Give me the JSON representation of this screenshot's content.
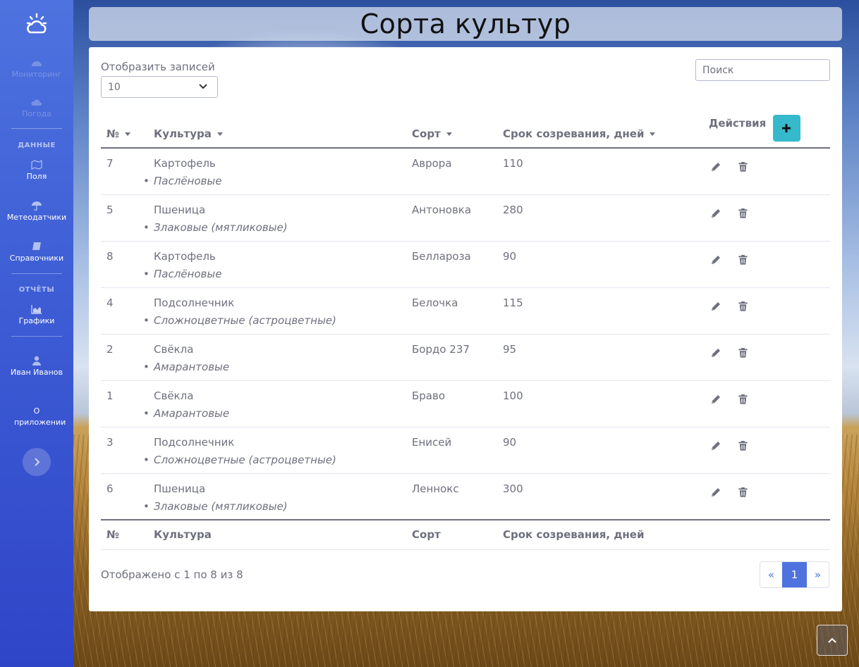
{
  "sidebar": {
    "items": [
      {
        "label": "Мониторинг",
        "icon": "gauge-icon",
        "enabled": false
      },
      {
        "label": "Погода",
        "icon": "weather-icon",
        "enabled": false
      },
      {
        "label": "Поля",
        "icon": "map-icon",
        "enabled": true
      },
      {
        "label": "Метеодатчики",
        "icon": "umbrella-icon",
        "enabled": true
      },
      {
        "label": "Справочники",
        "icon": "book-icon",
        "enabled": true
      },
      {
        "label": "Графики",
        "icon": "chart-icon",
        "enabled": true
      },
      {
        "label": "Иван Иванов",
        "icon": "user-icon",
        "enabled": true
      },
      {
        "label": "О приложении",
        "icon": "",
        "enabled": true
      }
    ],
    "headings": {
      "data": "ДАННЫЕ",
      "reports": "ОТЧЁТЫ"
    }
  },
  "page": {
    "title": "Сорта культур"
  },
  "controls": {
    "length_label": "Отобразить записей",
    "length_value": "10",
    "search_placeholder": "Поиск"
  },
  "table": {
    "columns": [
      "№",
      "Культура",
      "Сорт",
      "Срок созревания, дней",
      "Действия"
    ],
    "rows": [
      {
        "id": "7",
        "culture": "Картофель",
        "family": "Паслёновые",
        "variety": "Аврора",
        "days": "110"
      },
      {
        "id": "5",
        "culture": "Пшеница",
        "family": "Злаковые (мятликовые)",
        "variety": "Антоновка",
        "days": "280"
      },
      {
        "id": "8",
        "culture": "Картофель",
        "family": "Паслёновые",
        "variety": "Беллароза",
        "days": "90"
      },
      {
        "id": "4",
        "culture": "Подсолнечник",
        "family": "Сложноцветные (астроцветные)",
        "variety": "Белочка",
        "days": "115"
      },
      {
        "id": "2",
        "culture": "Свёкла",
        "family": "Амарантовые",
        "variety": "Бордо 237",
        "days": "95"
      },
      {
        "id": "1",
        "culture": "Свёкла",
        "family": "Амарантовые",
        "variety": "Браво",
        "days": "100"
      },
      {
        "id": "3",
        "culture": "Подсолнечник",
        "family": "Сложноцветные (астроцветные)",
        "variety": "Енисей",
        "days": "90"
      },
      {
        "id": "6",
        "culture": "Пшеница",
        "family": "Злаковые (мятликовые)",
        "variety": "Леннокс",
        "days": "300"
      }
    ]
  },
  "footer": {
    "info": "Отображено с 1 по 8 из 8",
    "pager": {
      "prev": "«",
      "current": "1",
      "next": "»"
    }
  },
  "colors": {
    "sidebar": "#4e73df",
    "accent": "#36b9cc",
    "primary": "#4e73df",
    "text": "#6e707e"
  }
}
